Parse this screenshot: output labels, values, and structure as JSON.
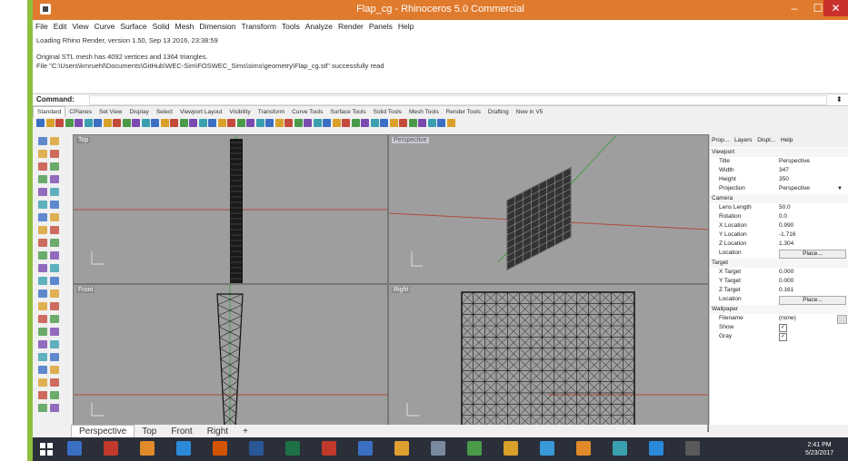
{
  "window": {
    "title": "Flap_cg - Rhinoceros 5.0 Commercial",
    "min_glyph": "–",
    "max_glyph": "☐",
    "close_glyph": "✕"
  },
  "menubar": [
    "File",
    "Edit",
    "View",
    "Curve",
    "Surface",
    "Solid",
    "Mesh",
    "Dimension",
    "Transform",
    "Tools",
    "Analyze",
    "Render",
    "Panels",
    "Help"
  ],
  "history": {
    "line1": "Loading Rhino Render, version 1.50, Sep 13 2016, 23:38:59",
    "line2": "Original STL mesh has 4092 vertices and 1364 triangles.",
    "line3": "File \"C:\\Users\\kmruehl\\Documents\\GitHub\\WEC-Sim\\FOSWEC_Sims\\sims\\geometry\\Flap_cg.stl\" successfully read"
  },
  "command": {
    "label": "Command:",
    "value": ""
  },
  "toolbar_tabs": [
    "Standard",
    "CPlanes",
    "Set View",
    "Display",
    "Select",
    "Viewport Layout",
    "Visibility",
    "Transform",
    "Curve Tools",
    "Surface Tools",
    "Solid Tools",
    "Mesh Tools",
    "Render Tools",
    "Drafting",
    "New in V5"
  ],
  "viewports": {
    "top": "Top",
    "perspective": "Perspective",
    "front": "Front",
    "right": "Right"
  },
  "viewport_tabs": [
    "Perspective",
    "Top",
    "Front",
    "Right"
  ],
  "panel_tabs": [
    "Prop...",
    "Layers",
    "Displ...",
    "Help"
  ],
  "properties": {
    "viewport_header": "Viewport",
    "title_k": "Title",
    "title_v": "Perspective",
    "width_k": "Width",
    "width_v": "347",
    "height_k": "Height",
    "height_v": "350",
    "projection_k": "Projection",
    "projection_v": "Perspective",
    "camera_header": "Camera",
    "lens_k": "Lens Length",
    "lens_v": "50.0",
    "rotation_k": "Rotation",
    "rotation_v": "0.0",
    "xloc_k": "X Location",
    "xloc_v": "0.990",
    "yloc_k": "Y Location",
    "yloc_v": "-1.716",
    "zloc_k": "Z Location",
    "zloc_v": "1.304",
    "location_k": "Location",
    "place_btn": "Place...",
    "target_header": "Target",
    "xt_k": "X Target",
    "xt_v": "0.000",
    "yt_k": "Y Target",
    "yt_v": "0.000",
    "zt_k": "Z Target",
    "zt_v": "0.161",
    "tloc_k": "Location",
    "tplace_btn": "Place...",
    "wallpaper_header": "Wallpaper",
    "filename_k": "Filename",
    "filename_v": "(none)",
    "show_k": "Show",
    "gray_k": "Gray",
    "check_glyph": "✓"
  },
  "taskbar": {
    "time": "2:41 PM",
    "date": "5/23/2017"
  },
  "colors": {
    "titlebar": "#e07a2c",
    "viewport": "#9e9e9e",
    "accent_green": "#8fbf3f",
    "close": "#c9302c"
  }
}
